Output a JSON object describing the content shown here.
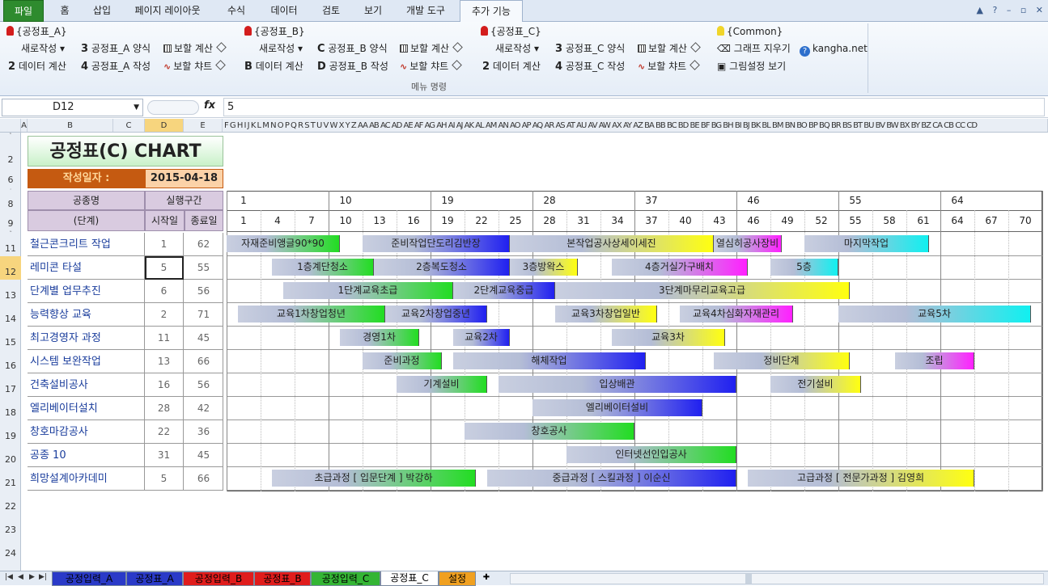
{
  "ribbon_tabs": [
    "파일",
    "홈",
    "삽입",
    "페이지 레이아웃",
    "수식",
    "데이터",
    "검토",
    "보기",
    "개발 도구",
    "추가 기능"
  ],
  "ribbon": {
    "group_a_header": "{공정표_A}",
    "group_b_header": "{공정표_B}",
    "group_c_header": "{공정표_C}",
    "group_common_header": "{Common}",
    "new_create": "새로작성",
    "data_calc": "데이터 계산",
    "a_form": "공정표_A 양식",
    "a_create": "공정표_A 작성",
    "b_form": "공정표_B 양식",
    "b_create": "공정표_B 작성",
    "c_form": "공정표_C 양식",
    "c_create": "공정표_C 작성",
    "aux_calc": "보할 계산",
    "aux_chart": "보할 챠트",
    "clear_graph": "그래프 지우기",
    "kangha": "kangha.net",
    "view_settings": "그림설정 보기",
    "num2": "2",
    "num3": "3",
    "num4": "4",
    "letter_b": "B",
    "letter_c": "C",
    "letter_d": "D",
    "caption": "메뉴 명령"
  },
  "formula_bar": {
    "cell": "D12",
    "fx": "fx",
    "content": "5"
  },
  "col_headers": [
    "A",
    "B",
    "C",
    "D",
    "E",
    "F G H I J K L M N O P Q R S T U V W X Y Z AA AB AC AD AE AF AG AH AI AJ AK AL AM AN AO AP AQ AR AS AT AU AV AW AX AY AZ BA BB BC BD BE BF BG BH BI BJ BK BL BM BN BO BP BQ BR BS BT BU BV BW BX BY BZ CA CB CC CD"
  ],
  "row_headers": [
    "1",
    "2",
    "6",
    "7",
    "8",
    "9",
    "10",
    "11",
    "12",
    "13",
    "14",
    "15",
    "16",
    "17",
    "18",
    "19",
    "20",
    "21",
    "22",
    "23",
    "24"
  ],
  "title": "공정표(C) CHART",
  "date_label": "작성일자 :",
  "date_value": "2015-04-18",
  "table_headers": {
    "task": "공종명",
    "task_sub": "(단계)",
    "interval": "실행구간",
    "start": "시작일",
    "end": "종료일"
  },
  "gantt_major": [
    "1",
    "10",
    "19",
    "28",
    "37",
    "46",
    "55",
    "64"
  ],
  "gantt_minor": [
    "1",
    "4",
    "7",
    "10",
    "13",
    "16",
    "19",
    "22",
    "25",
    "28",
    "31",
    "34",
    "37",
    "40",
    "43",
    "46",
    "49",
    "52",
    "55",
    "58",
    "61",
    "64",
    "67",
    "70"
  ],
  "rows": [
    {
      "name": "철근콘크리트 작업",
      "start": "1",
      "end": "62",
      "bars": [
        {
          "label": "자재준비앵글90*90",
          "from": 1,
          "to": 11,
          "color": "#22dd22"
        },
        {
          "label": "준비작업단도리김반장",
          "from": 13,
          "to": 26,
          "color": "#2020f0"
        },
        {
          "label": "본작업공사상세이세진",
          "from": 26,
          "to": 44,
          "color": "#ffff10"
        },
        {
          "label": "열심히공사장비",
          "from": 44,
          "to": 50,
          "color": "#ff20ff"
        },
        {
          "label": "마지막작업",
          "from": 52,
          "to": 63,
          "color": "#10f0f0"
        }
      ]
    },
    {
      "name": "레미콘 타설",
      "start": "5",
      "end": "55",
      "bars": [
        {
          "label": "1층계단청소",
          "from": 5,
          "to": 14,
          "color": "#22dd22"
        },
        {
          "label": "2층복도청소",
          "from": 14,
          "to": 26,
          "color": "#2020f0"
        },
        {
          "label": "3층방왁스",
          "from": 26,
          "to": 32,
          "color": "#ffff10"
        },
        {
          "label": "4층거실가구배치",
          "from": 35,
          "to": 47,
          "color": "#ff20ff"
        },
        {
          "label": "5층",
          "from": 49,
          "to": 55,
          "color": "#10f0f0"
        }
      ]
    },
    {
      "name": "단계별 업무추진",
      "start": "6",
      "end": "56",
      "bars": [
        {
          "label": "1단계교육초급",
          "from": 6,
          "to": 21,
          "color": "#22dd22"
        },
        {
          "label": "2단계교육중급",
          "from": 21,
          "to": 30,
          "color": "#2020f0"
        },
        {
          "label": "3단계마무리교육고급",
          "from": 30,
          "to": 56,
          "color": "#ffff10"
        }
      ]
    },
    {
      "name": "능력향상 교육",
      "start": "2",
      "end": "71",
      "bars": [
        {
          "label": "교육1차창업청년",
          "from": 2,
          "to": 15,
          "color": "#22dd22"
        },
        {
          "label": "교육2차창업중년",
          "from": 15,
          "to": 24,
          "color": "#2020f0"
        },
        {
          "label": "교육3차창업일반",
          "from": 30,
          "to": 39,
          "color": "#ffff10"
        },
        {
          "label": "교육4차심화자재관리",
          "from": 41,
          "to": 51,
          "color": "#ff20ff"
        },
        {
          "label": "교육5차",
          "from": 55,
          "to": 72,
          "color": "#10f0f0"
        }
      ]
    },
    {
      "name": "최고경영자 과정",
      "start": "11",
      "end": "45",
      "bars": [
        {
          "label": "경영1차",
          "from": 11,
          "to": 18,
          "color": "#22dd22"
        },
        {
          "label": "교육2차",
          "from": 21,
          "to": 26,
          "color": "#2020f0"
        },
        {
          "label": "교육3차",
          "from": 35,
          "to": 45,
          "color": "#ffff10"
        }
      ]
    },
    {
      "name": "시스템 보완작업",
      "start": "13",
      "end": "66",
      "bars": [
        {
          "label": "준비과정",
          "from": 13,
          "to": 20,
          "color": "#22dd22"
        },
        {
          "label": "해체작업",
          "from": 21,
          "to": 38,
          "color": "#2020f0"
        },
        {
          "label": "정비단계",
          "from": 44,
          "to": 56,
          "color": "#ffff10"
        },
        {
          "label": "조립",
          "from": 60,
          "to": 67,
          "color": "#ff20ff"
        }
      ]
    },
    {
      "name": "건축설비공사",
      "start": "16",
      "end": "56",
      "bars": [
        {
          "label": "기계설비",
          "from": 16,
          "to": 24,
          "color": "#22dd22"
        },
        {
          "label": "입상배관",
          "from": 25,
          "to": 46,
          "color": "#2020f0"
        },
        {
          "label": "전기설비",
          "from": 49,
          "to": 57,
          "color": "#ffff10"
        }
      ]
    },
    {
      "name": "엘리베이터설치",
      "start": "28",
      "end": "42",
      "bars": [
        {
          "label": "엘리베이터설비",
          "from": 28,
          "to": 43,
          "color": "#2020f0"
        }
      ]
    },
    {
      "name": "창호마감공사",
      "start": "22",
      "end": "36",
      "bars": [
        {
          "label": "창호공사",
          "from": 22,
          "to": 37,
          "color": "#22dd22"
        }
      ]
    },
    {
      "name": "공종 10",
      "start": "31",
      "end": "45",
      "bars": [
        {
          "label": "인터넷선인입공사",
          "from": 31,
          "to": 46,
          "color": "#22dd22"
        }
      ]
    },
    {
      "name": "희망설계아카데미",
      "start": "5",
      "end": "66",
      "bars": [
        {
          "label": "초급과정 [ 입문단계 ] 박강하",
          "from": 5,
          "to": 23,
          "color": "#22dd22"
        },
        {
          "label": "중급과정 [ 스킬과정 ] 이순신",
          "from": 24,
          "to": 46,
          "color": "#2020f0"
        },
        {
          "label": "고급과정 [ 전문가과정 ] 김영희",
          "from": 47,
          "to": 67,
          "color": "#ffff10"
        }
      ]
    }
  ],
  "sheet_tabs": [
    {
      "label": "공정입력_A",
      "color": "#2a3ac8"
    },
    {
      "label": "공정표_A",
      "color": "#2a3ac8"
    },
    {
      "label": "공정입력_B",
      "color": "#e01c1c"
    },
    {
      "label": "공정표_B",
      "color": "#e01c1c"
    },
    {
      "label": "공정입력_C",
      "color": "#34b534"
    },
    {
      "label": "공정표_C",
      "color": "#ffffff"
    },
    {
      "label": "설정",
      "color": "#f0a020"
    }
  ]
}
